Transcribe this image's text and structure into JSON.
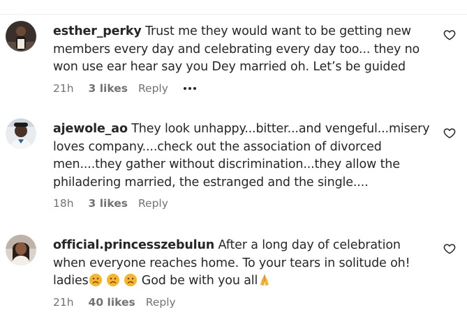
{
  "comments": [
    {
      "username": "esther_perky",
      "text": "Trust me they would want to be getting new members every day and celebrating every day too... they no won use ear hear say you Dey married oh. Let’s be guided",
      "time": "21h",
      "likes": "3 likes",
      "reply": "Reply",
      "like_icon": "heart-outline-icon"
    },
    {
      "username": "ajewole_ao",
      "text": "They look unhappy...bitter...and vengeful...misery loves company....check out the association of divorced men....they gather without discrimination...they allow the philadering married, the estranged and the single....",
      "time": "18h",
      "likes": "3 likes",
      "reply": "Reply",
      "like_icon": "heart-outline-icon"
    },
    {
      "username": "official.princesszebulun",
      "text_part1": "After a long day of celebration when everyone reaches home. To your tears in solitude oh! ladies",
      "text_part2": " God be with you all",
      "time": "21h",
      "likes": "40 likes",
      "reply": "Reply",
      "like_icon": "heart-outline-icon",
      "emojis": [
        "sad-face-emoji",
        "sad-face-emoji",
        "sad-face-emoji",
        "praying-hands-emoji"
      ]
    }
  ],
  "colors": {
    "text": "#262626",
    "meta": "#737373",
    "divider": "#efefef",
    "emoji_yellow": "#f7b52a"
  }
}
